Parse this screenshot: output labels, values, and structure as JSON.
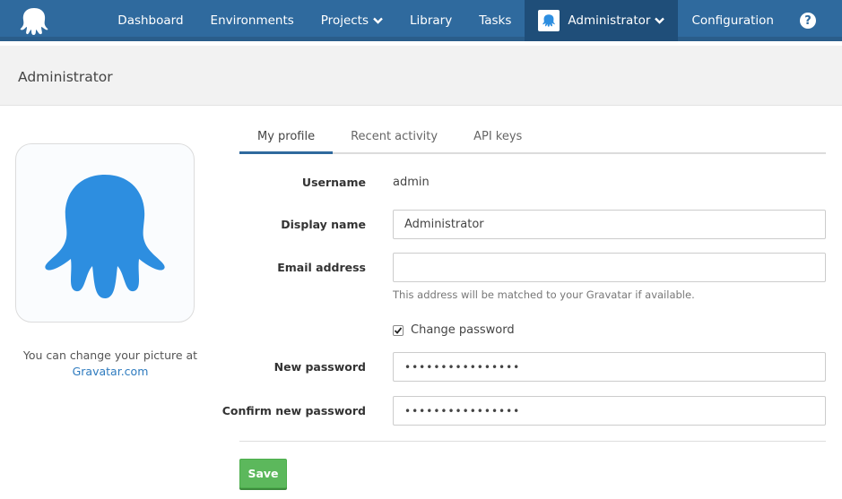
{
  "brand": {
    "logo_icon": "octopus-logo-icon",
    "accent": "#2f6a9e",
    "accent_dark": "#1f4e79",
    "avatar_color": "#2d8ee0"
  },
  "nav": {
    "items": [
      {
        "label": "Dashboard"
      },
      {
        "label": "Environments"
      },
      {
        "label": "Projects",
        "has_dropdown": true
      },
      {
        "label": "Library"
      },
      {
        "label": "Tasks"
      },
      {
        "label": "Administrator",
        "has_dropdown": true,
        "active": true
      },
      {
        "label": "Configuration"
      }
    ],
    "help_icon": "question-circle-icon",
    "help_glyph": "?"
  },
  "page": {
    "title": "Administrator"
  },
  "avatar": {
    "caption": "You can change your picture at",
    "link_text": "Gravatar.com"
  },
  "tabs": [
    {
      "label": "My profile",
      "active": true
    },
    {
      "label": "Recent activity"
    },
    {
      "label": "API keys"
    }
  ],
  "form": {
    "username_label": "Username",
    "username_value": "admin",
    "display_name_label": "Display name",
    "display_name_value": "Administrator",
    "email_label": "Email address",
    "email_value": "",
    "email_hint": "This address will be matched to your Gravatar if available.",
    "change_password_label": "Change password",
    "change_password_checked": true,
    "new_password_label": "New password",
    "new_password_value": "••••••••••••••••",
    "confirm_password_label": "Confirm new password",
    "confirm_password_value": "••••••••••••••••",
    "save_label": "Save",
    "save_color": "#5cb85c"
  }
}
